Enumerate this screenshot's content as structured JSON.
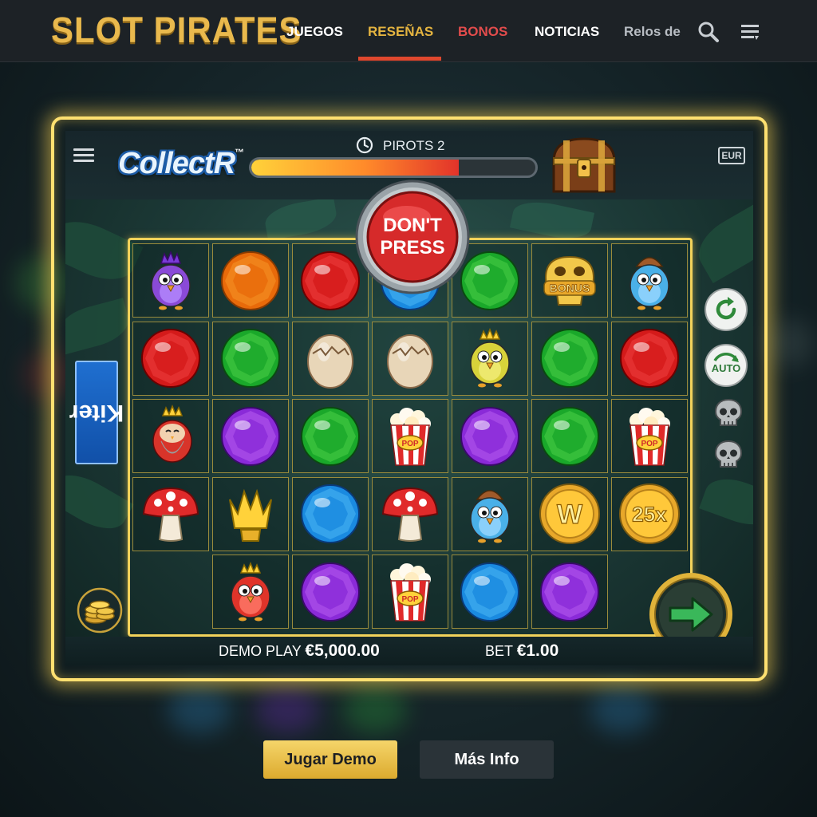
{
  "site": {
    "logo": "SLOT PIRATES",
    "nav": {
      "juegos": "JUEGOS",
      "resenas": "RESEÑAS",
      "bonos": "BONOS",
      "noticias": "NOTICIAS",
      "relos": "Relos de"
    },
    "active_nav": "RESEÑAS",
    "colors": {
      "logo": "#e9b94d",
      "active": "#e4b440",
      "bonos": "#e24c4c",
      "underline": "#e0482e"
    }
  },
  "game": {
    "title": "CollectR",
    "title_mark": "™",
    "level_label": "PIROTS 2",
    "progress": 0.73,
    "currency_badge": "EUR",
    "dont_press": {
      "line1": "DON'T",
      "line2": "PRESS"
    },
    "side_banner": "Kiter",
    "side_banner_mark": "™",
    "auto_label": "AUTO",
    "bonus_label": "BONUS",
    "wild_label": "W",
    "multiplier_label": "25x",
    "pop_label": "POP",
    "grid": [
      [
        "bird-purple-king",
        "gem-orange",
        "gem-red",
        "gem-blue",
        "gem-green",
        "bonus-skull",
        "bird-blue-hat"
      ],
      [
        "gem-red",
        "gem-green",
        "egg",
        "egg",
        "bird-yellow-crown",
        "gem-green",
        "gem-red"
      ],
      [
        "bird-red-king",
        "gem-purple",
        "gem-green",
        "popcorn",
        "gem-purple",
        "gem-green",
        "popcorn"
      ],
      [
        "mushroom",
        "crown",
        "gem-blue",
        "mushroom",
        "bird-blue-hat",
        "wild-coin",
        "multiplier-coin"
      ],
      [
        null,
        "bird-red-crown",
        "gem-purple",
        "popcorn",
        "gem-blue",
        "gem-purple",
        null
      ]
    ],
    "demo_label": "DEMO PLAY",
    "demo_balance": "€5,000.00",
    "bet_label": "BET",
    "bet_value": "€1.00"
  },
  "actions": {
    "play_demo": "Jugar Demo",
    "more_info": "Más Info"
  }
}
